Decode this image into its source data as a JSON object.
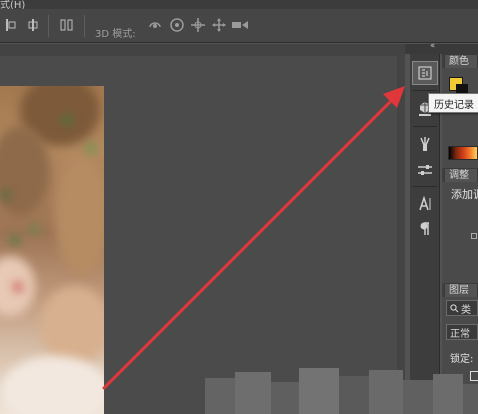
{
  "menubar": {
    "fragment": "式(H)"
  },
  "options_bar": {
    "mode_label": "3D 模式:",
    "icons": [
      "distribute-icon",
      "distribute-icon",
      "align-icon",
      "rotate-3d-icon",
      "roll-3d-icon",
      "pan-3d-icon",
      "slide-3d-icon",
      "scale-3d-icon"
    ]
  },
  "panel_dock": {
    "collapse_label": "‹‹",
    "buttons": [
      "history-icon",
      "3d-icon",
      "brush-icon",
      "properties-icon",
      "character-icon",
      "paragraph-icon"
    ]
  },
  "tooltip": {
    "text": "历史记录"
  },
  "color_panel": {
    "tab": "颜色",
    "foreground_color": "#f0c934",
    "background_color": "#111111"
  },
  "adjustments_panel": {
    "tab": "调整",
    "add_label": "添加调"
  },
  "layers_panel": {
    "tab": "图层",
    "kind_filter": "类",
    "blend_mode": "正常",
    "lock_label": "锁定:"
  },
  "colors": {
    "annotation_arrow": "#e0373b",
    "workspace": "#4b4b4b"
  }
}
